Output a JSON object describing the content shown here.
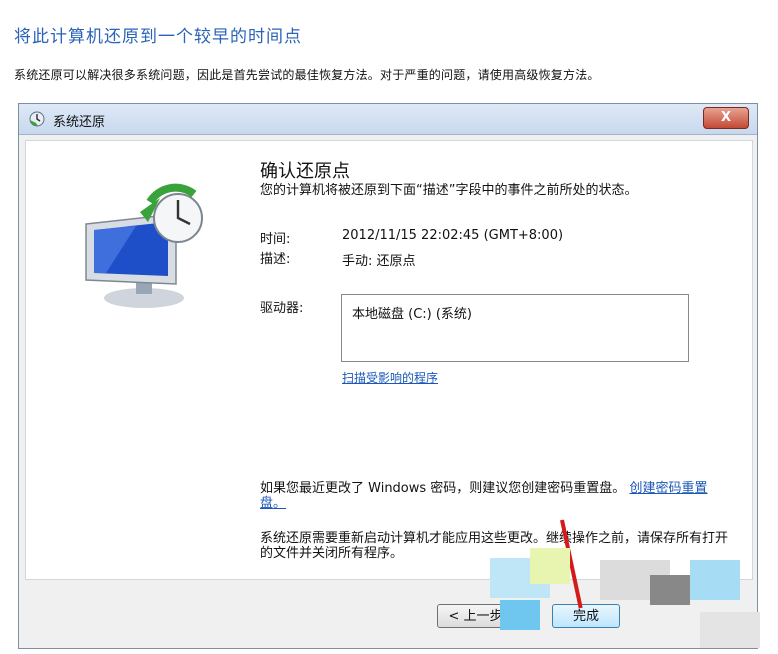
{
  "page": {
    "heading": "将此计算机还原到一个较早的时间点",
    "subtext": "系统还原可以解决很多系统问题，因此是首先尝试的最佳恢复方法。对于严重的问题，请使用高级恢复方法。"
  },
  "window": {
    "title": "系统还原",
    "close_label": "X"
  },
  "content": {
    "confirm_title": "确认还原点",
    "description": "您的计算机将被还原到下面“描述”字段中的事件之前所处的状态。",
    "time_label": "时间:",
    "time_value": "2012/11/15 22:02:45 (GMT+8:00)",
    "desc_label": "描述:",
    "desc_value": "手动: 还原点",
    "drives_label": "驱动器:",
    "drives": [
      "本地磁盘 (C:) (系统)"
    ],
    "scan_link": "扫描受影响的程序",
    "note_password": "如果您最近更改了 Windows 密码，则建议您创建密码重置盘。",
    "note_password_link": "创建密码重置盘。",
    "note_restart": "系统还原需要重新启动计算机才能应用这些更改。继续操作之前，请保存所有打开的文件并关闭所有程序。"
  },
  "footer": {
    "back_label": "< 上一步(B)",
    "finish_label": "完成"
  }
}
